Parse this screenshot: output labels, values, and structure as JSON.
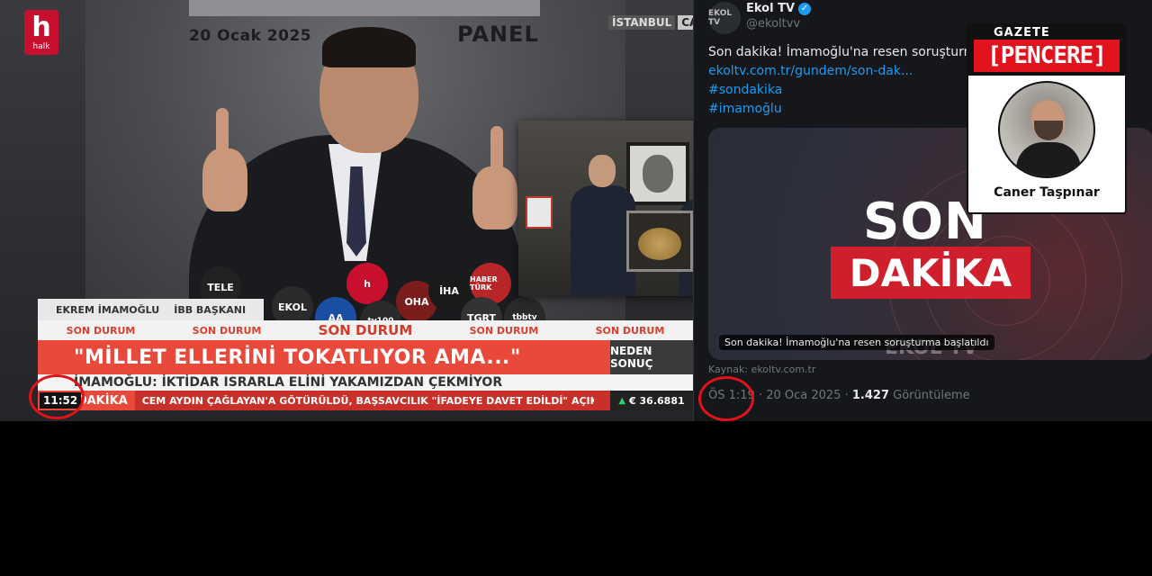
{
  "tv": {
    "channel_logo_big": "h",
    "channel_logo_small": "halk",
    "date": "20 Ocak 2025",
    "panel": "PANEL",
    "city": "İSTANBUL",
    "live": "CANLI",
    "nameplate_name": "EKREM İMAMOĞLU",
    "nameplate_title": "İBB BAŞKANI",
    "status_small": "SON DURUM",
    "status_main": "SON DURUM",
    "headline": "\"MİLLET ELLERİNİ TOKATLIYOR AMA...\"",
    "neden": "NEDEN SONUÇ",
    "subline": "İMAMOĞLU: İKTİDAR ISRARLA ELİNİ YAKAMIZDAN ÇEKMİYOR",
    "ticker_label": "SON DAKİKA",
    "ticker_text": "CEM AYDIN ÇAĞLAYAN'A GÖTÜRÜLDÜ, BAŞSAVCILIK \"İFADEYE DAVET EDİLDİ\" AÇIKLAM",
    "eur": "€ 36.6881",
    "clock": "11:52",
    "mics": [
      "TELE",
      "h",
      "EKOL",
      "AA",
      "OHA",
      "İHA",
      "HABER TÜRK",
      "TGRT",
      "tv100",
      "tbbtv"
    ]
  },
  "tweet": {
    "avatar": "EKOL TV",
    "name": "Ekol TV",
    "handle": "@ekoltvv",
    "text": "Son dakika! İmamoğlu'na resen soruşturma",
    "link": "ekoltv.com.tr/gundem/son-dak...",
    "tags": [
      "#sondakika",
      "#imamoğlu"
    ],
    "card_son": "SON",
    "card_dakika": "DAKİKA",
    "card_faint": "EKOL TV",
    "card_caption": "Son dakika! İmamoğlu'na resen soruşturma başlatıldı",
    "source": "Kaynak: ekoltv.com.tr",
    "time": "ÖS 1:19",
    "date": "20 Oca 2025",
    "views": "1.427",
    "views_label": "Görüntüleme"
  },
  "badge": {
    "gazete": "GAZETE",
    "pencere": "[PENCERE]",
    "author": "Caner Taşpınar"
  },
  "colors": {
    "highlight_circle": "#e0121a",
    "ticker_red": "#e9493a",
    "tweet_link": "#1d9bf0"
  }
}
